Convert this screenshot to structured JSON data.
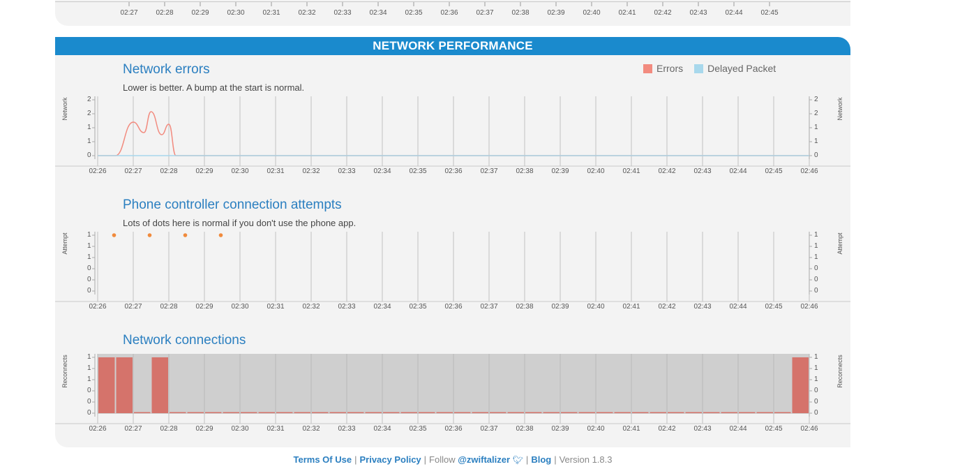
{
  "top_axis": {
    "ticks": [
      "02:27",
      "02:28",
      "02:29",
      "02:30",
      "02:31",
      "02:32",
      "02:33",
      "02:34",
      "02:35",
      "02:36",
      "02:37",
      "02:38",
      "02:39",
      "02:40",
      "02:41",
      "02:42",
      "02:43",
      "02:44",
      "02:45"
    ]
  },
  "section": {
    "title": "NETWORK PERFORMANCE"
  },
  "x_ticks": [
    "02:26",
    "02:27",
    "02:28",
    "02:29",
    "02:30",
    "02:31",
    "02:32",
    "02:33",
    "02:34",
    "02:35",
    "02:36",
    "02:37",
    "02:38",
    "02:39",
    "02:40",
    "02:41",
    "02:42",
    "02:43",
    "02:44",
    "02:45",
    "02:46"
  ],
  "network_errors": {
    "title": "Network errors",
    "subtitle": "Lower is better. A bump at the start is normal.",
    "ylabel": "Network",
    "yticks": [
      "2",
      "2",
      "1",
      "1",
      "0"
    ],
    "legend": [
      {
        "label": "Errors",
        "color": "#f28b7f"
      },
      {
        "label": "Delayed Packet",
        "color": "#a8d8ec"
      }
    ]
  },
  "phone_attempts": {
    "title": "Phone controller connection attempts",
    "subtitle": "Lots of dots here is normal if you don't use the phone app.",
    "ylabel": "Attempt",
    "yticks": [
      "1",
      "1",
      "1",
      "0",
      "0",
      "0"
    ]
  },
  "network_connections": {
    "title": "Network connections",
    "ylabel": "Reconnects",
    "yticks": [
      "1",
      "1",
      "1",
      "0",
      "0",
      "0"
    ]
  },
  "chart_data": [
    {
      "type": "line",
      "title": "Network errors",
      "ylabel": "Network",
      "x": [
        "02:26",
        "02:26.5",
        "02:27",
        "02:27.3",
        "02:27.5",
        "02:27.8",
        "02:28",
        "02:28.2",
        "02:30",
        "02:46"
      ],
      "series": [
        {
          "name": "Errors",
          "color": "#f28b7f",
          "values": [
            0,
            0,
            1.6,
            1.1,
            2.1,
            1.0,
            1.5,
            0,
            0,
            0
          ]
        },
        {
          "name": "Delayed Packet",
          "color": "#a8d8ec",
          "values": [
            0,
            0,
            0,
            0,
            0,
            0,
            0,
            0,
            0,
            0
          ]
        }
      ]
    },
    {
      "type": "scatter",
      "title": "Phone controller connection attempts",
      "ylabel": "Attempt",
      "series": [
        {
          "color": "#f08a3c",
          "x": [
            "02:26.5",
            "02:27.5",
            "02:28.5",
            "02:29.5"
          ],
          "values": [
            1,
            1,
            1,
            1
          ]
        }
      ]
    },
    {
      "type": "bar",
      "title": "Network connections",
      "ylabel": "Reconnects",
      "categories": [
        "02:26",
        "02:26.5",
        "02:27",
        "02:27.5",
        "02:28",
        "02:28.5",
        "02:29",
        "02:29.5",
        "02:30",
        "02:30.5",
        "02:31",
        "02:31.5",
        "02:32",
        "02:32.5",
        "02:33",
        "02:33.5",
        "02:34",
        "02:34.5",
        "02:35",
        "02:35.5",
        "02:36",
        "02:36.5",
        "02:37",
        "02:37.5",
        "02:38",
        "02:38.5",
        "02:39",
        "02:39.5",
        "02:40",
        "02:40.5",
        "02:41",
        "02:41.5",
        "02:42",
        "02:42.5",
        "02:43",
        "02:43.5",
        "02:44",
        "02:44.5",
        "02:45",
        "02:45.5"
      ],
      "values": [
        1,
        1,
        0,
        1,
        0,
        0,
        0,
        0,
        0,
        0,
        0,
        0,
        0,
        0,
        0,
        0,
        0,
        0,
        0,
        0,
        0,
        0,
        0,
        0,
        0,
        0,
        0,
        0,
        0,
        0,
        0,
        0,
        0,
        0,
        0,
        0,
        0,
        0,
        0,
        1
      ],
      "color": "#d5736b"
    }
  ],
  "footer": {
    "terms": "Terms Of Use",
    "privacy": "Privacy Policy",
    "follow_prefix": "Follow",
    "twitter": "@zwiftalizer",
    "blog": "Blog",
    "version": "Version 1.8.3"
  }
}
